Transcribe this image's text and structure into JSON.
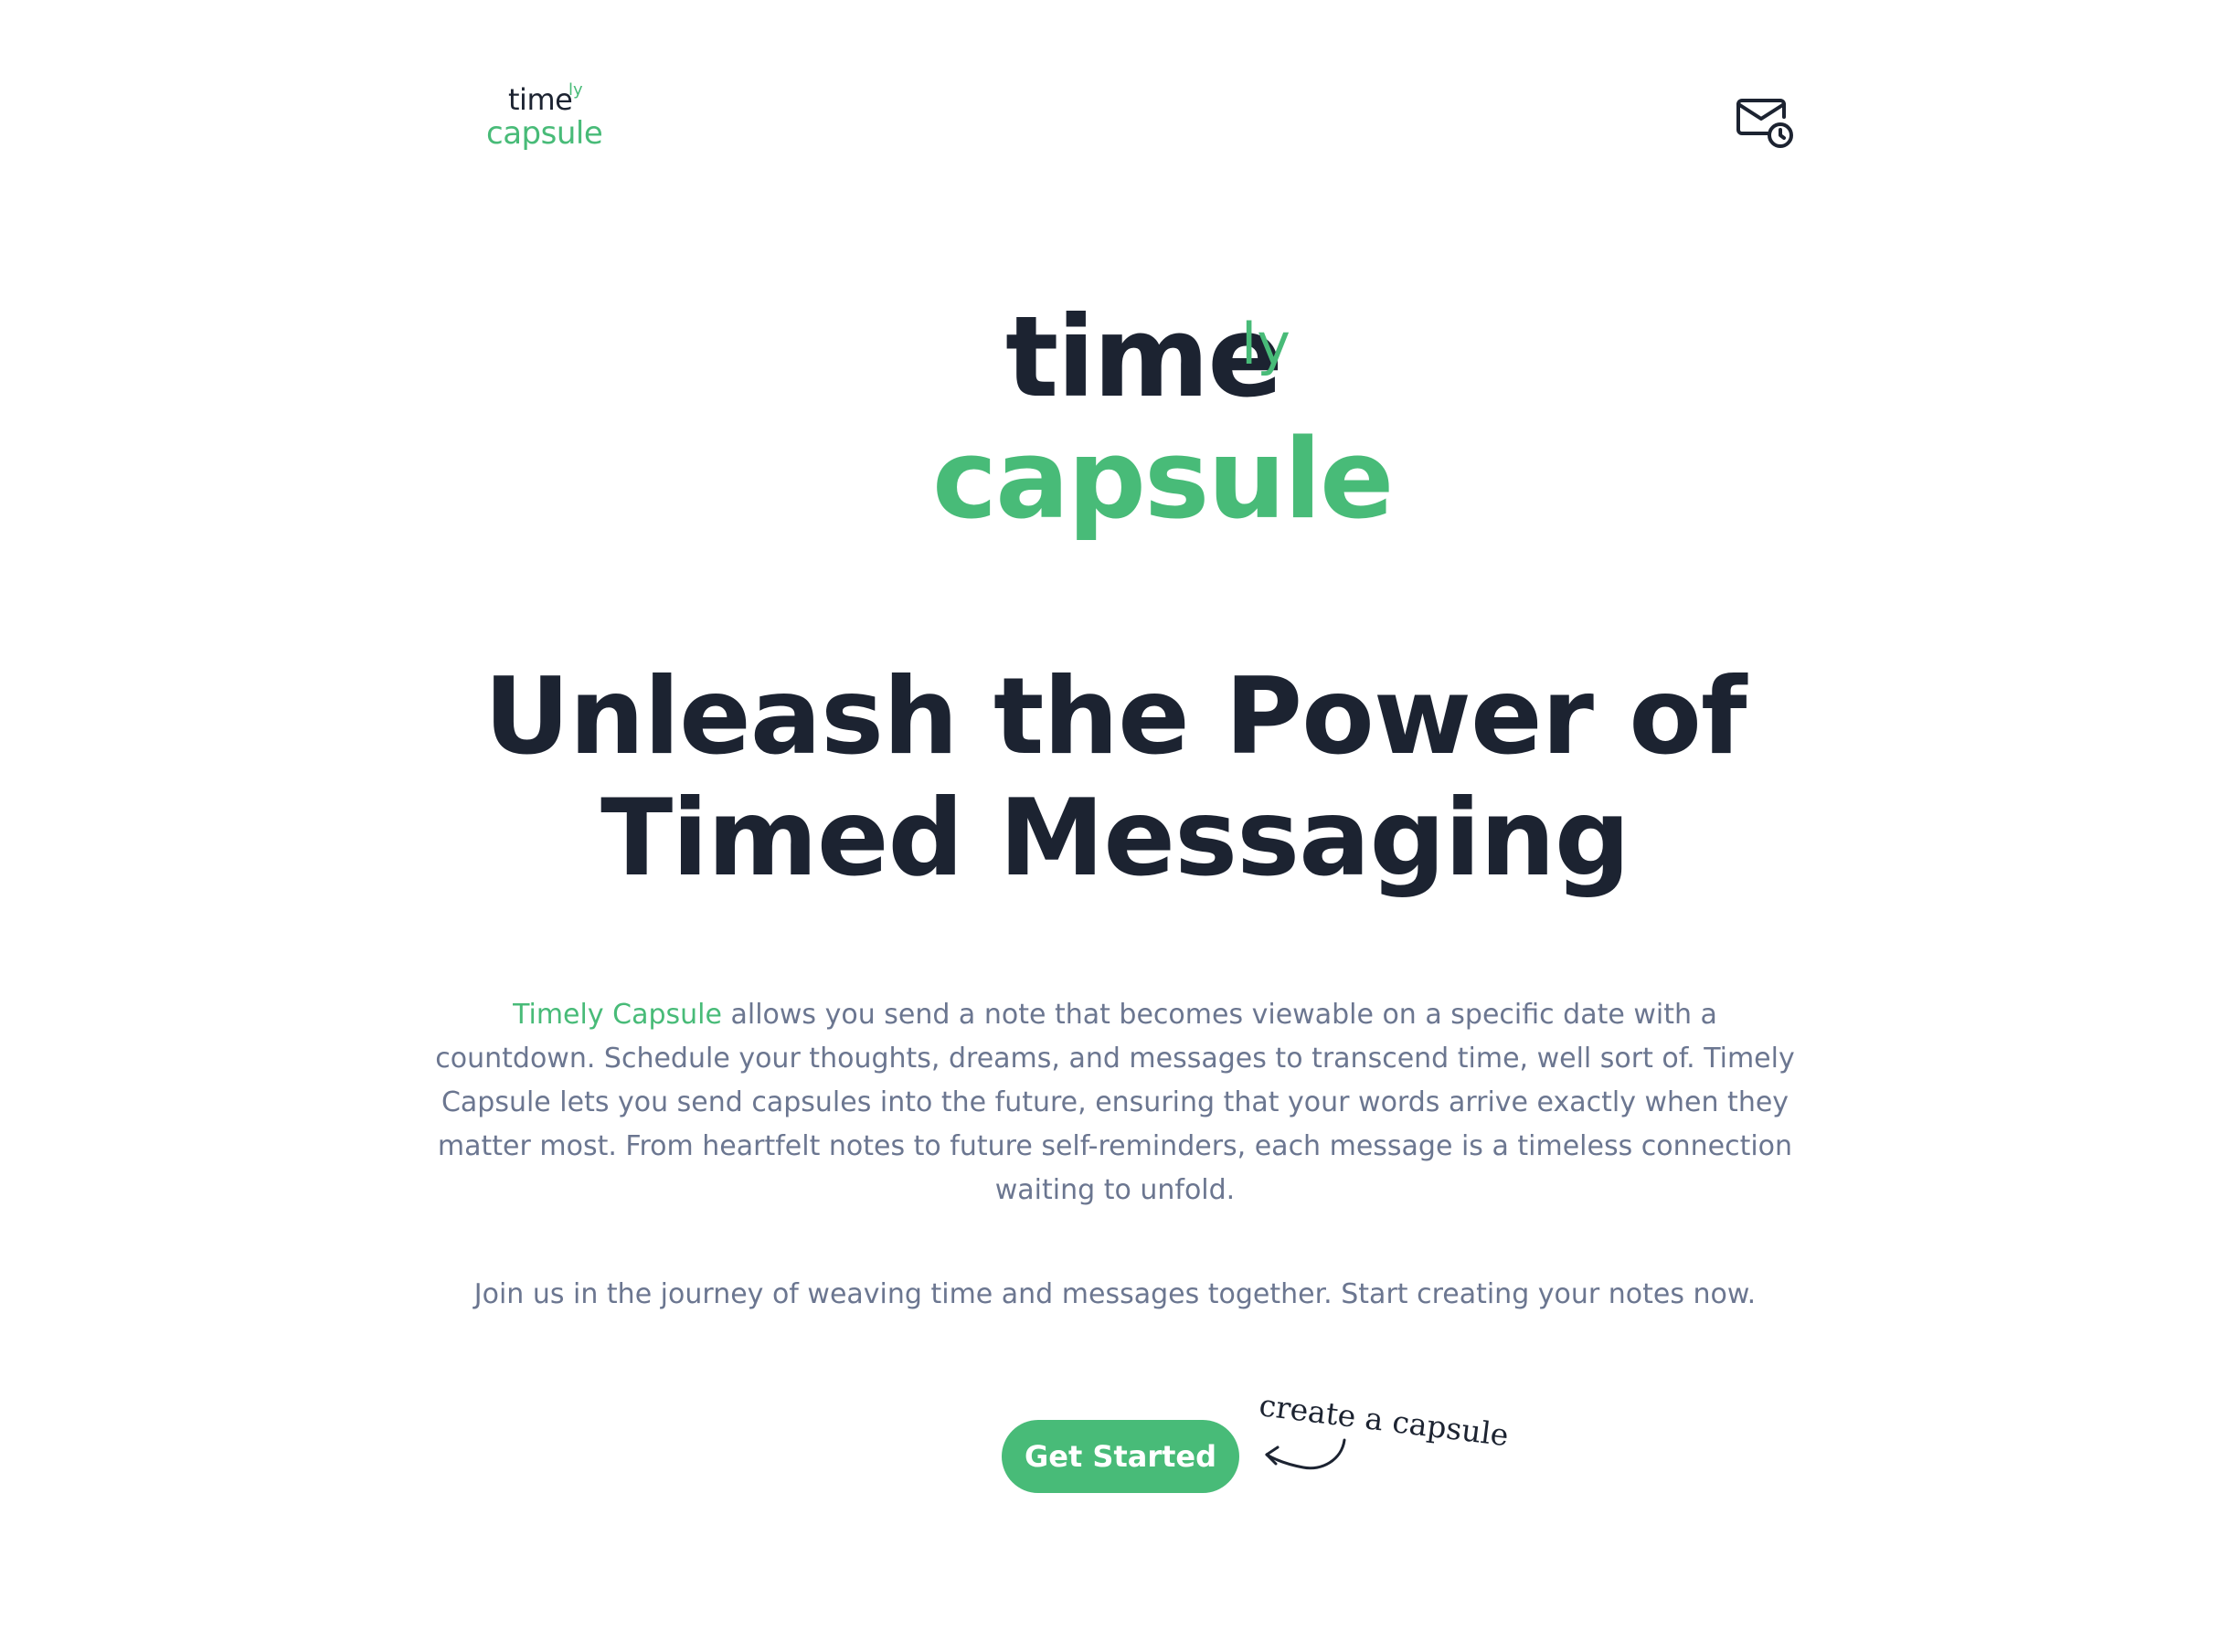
{
  "header": {
    "logo": {
      "word_time": "time",
      "word_ly": "ly",
      "word_capsule": "capsule"
    },
    "mail_icon": "mail-clock-icon"
  },
  "hero": {
    "logo": {
      "word_time": "time",
      "word_ly": "ly",
      "word_capsule": "capsule"
    },
    "headline": "Unleash the Power of Timed Messaging",
    "description_brand": "Timely Capsule",
    "description_rest": " allows you send a note that becomes viewable on a specific date with a countdown. Schedule your thoughts, dreams, and messages to transcend time, well sort of. Timely Capsule lets you send capsules into the future, ensuring that your words arrive exactly when they matter most. From heartfelt notes to future self-reminders, each message is a timeless connection waiting to unfold.",
    "join_text": "Join us in the journey of weaving time and messages together. Start creating your notes now.",
    "cta_label": "Get Started",
    "annotation": "create a capsule",
    "annotation_icon": "curved-arrow-icon"
  },
  "colors": {
    "brand_green": "#48bb78",
    "text_dark": "#1c2331",
    "text_muted": "#6b7690",
    "background": "#ffffff"
  }
}
